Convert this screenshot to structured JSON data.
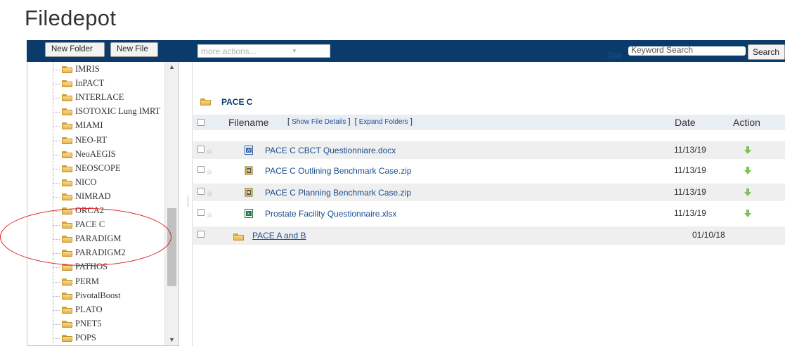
{
  "page": {
    "title": "Filedepot"
  },
  "toolbar": {
    "new_folder": "New Folder",
    "new_file": "New File",
    "more_actions": "more actions...",
    "tags_label": "Tags",
    "search_placeholder": "Keyword Search",
    "search_button": "Search"
  },
  "tree": {
    "items": [
      "IMRIS",
      "InPACT",
      "INTERLACE",
      "ISOTOXIC Lung IMRT",
      "MIAMI",
      "NEO-RT",
      "NeoAEGIS",
      "NEOSCOPE",
      "NICO",
      "NIMRAD",
      "ORCA2",
      "PACE C",
      "PARADIGM",
      "PARADIGM2",
      "PATHOS",
      "PERM",
      "PivotalBoost",
      "PLATO",
      "PNET5",
      "POPS"
    ]
  },
  "folder": {
    "name": "PACE C",
    "header": {
      "filename": "Filename",
      "show_details": "Show File Details",
      "expand_folders": "Expand Folders",
      "date": "Date",
      "action": "Action"
    },
    "files": [
      {
        "name": "PACE C CBCT Questionniare.docx",
        "date": "11/13/19",
        "type": "word"
      },
      {
        "name": "PACE C Outlining Benchmark Case.zip",
        "date": "11/13/19",
        "type": "zip"
      },
      {
        "name": "PACE C Planning Benchmark Case.zip",
        "date": "11/13/19",
        "type": "zip"
      },
      {
        "name": "Prostate Facility Questionnaire.xlsx",
        "date": "11/13/19",
        "type": "excel"
      }
    ],
    "subfolders": [
      {
        "name": "PACE A and B",
        "date": "01/10/18"
      }
    ]
  },
  "colors": {
    "toolbar_bg": "#0a3b6a",
    "link": "#1a4d8f",
    "highlight": "#e02020",
    "download_arrow": "#7fbf5a"
  }
}
